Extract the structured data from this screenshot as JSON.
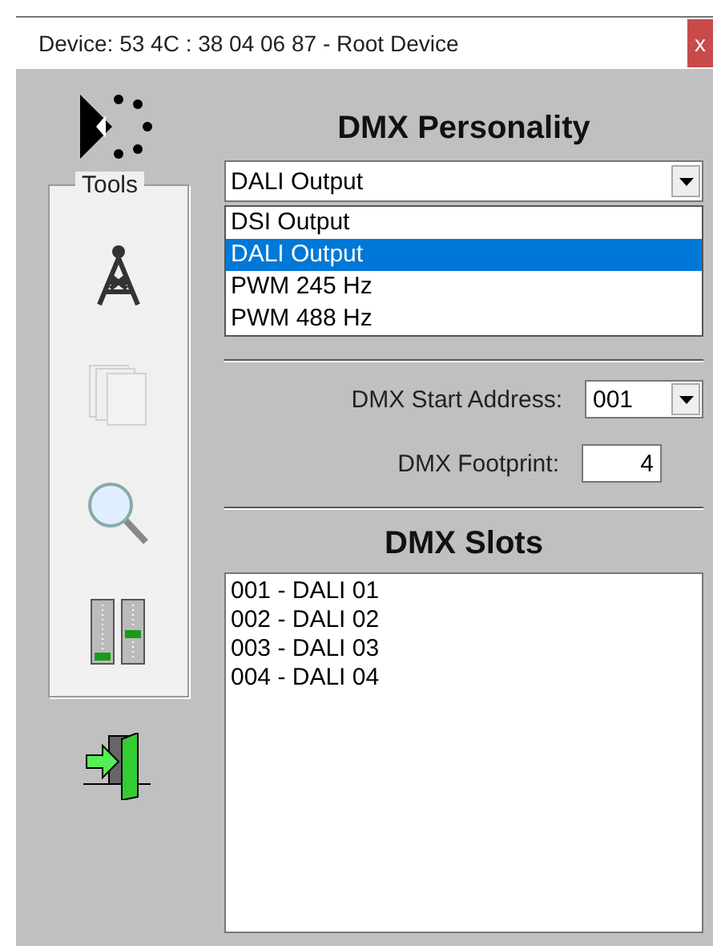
{
  "window": {
    "title": "Device:  53 4C : 38 04 06 87 - Root Device",
    "close": "x"
  },
  "tools": {
    "label": "Tools",
    "items": [
      {
        "kind": "tower",
        "disabled": false
      },
      {
        "kind": "pages",
        "disabled": true
      },
      {
        "kind": "search",
        "disabled": false
      },
      {
        "kind": "meters",
        "disabled": false
      }
    ]
  },
  "personality": {
    "heading": "DMX Personality",
    "value": "DALI Output",
    "expanded": true,
    "options": [
      {
        "label": "DSI  Output",
        "selected": false
      },
      {
        "label": "DALI Output",
        "selected": true
      },
      {
        "label": "PWM  245 Hz",
        "selected": false
      },
      {
        "label": "PWM  488 Hz",
        "selected": false
      }
    ]
  },
  "start_address": {
    "label": "DMX Start Address:",
    "value": "001"
  },
  "footprint": {
    "label": "DMX Footprint:",
    "value": "4"
  },
  "slots": {
    "heading": "DMX Slots",
    "items": [
      "001 - DALI  01",
      "002 - DALI  02",
      "003 - DALI  03",
      "004 - DALI  04"
    ]
  }
}
